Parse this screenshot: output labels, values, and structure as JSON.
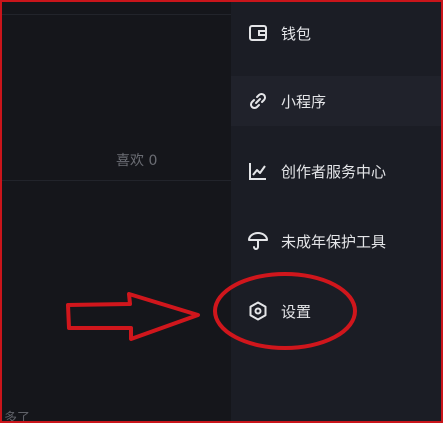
{
  "background": {
    "likes_text": "喜欢 0",
    "bottom_partial_text": "多了"
  },
  "drawer": {
    "items": [
      {
        "label": "钱包",
        "icon": "wallet-icon"
      },
      {
        "label": "小程序",
        "icon": "link-icon"
      },
      {
        "label": "创作者服务中心",
        "icon": "chart-line-icon"
      },
      {
        "label": "未成年保护工具",
        "icon": "umbrella-icon"
      },
      {
        "label": "设置",
        "icon": "hexagon-settings-icon"
      }
    ]
  },
  "annotation": {
    "color": "#d0161c",
    "shapes": [
      "border",
      "arrow",
      "ellipse"
    ]
  }
}
